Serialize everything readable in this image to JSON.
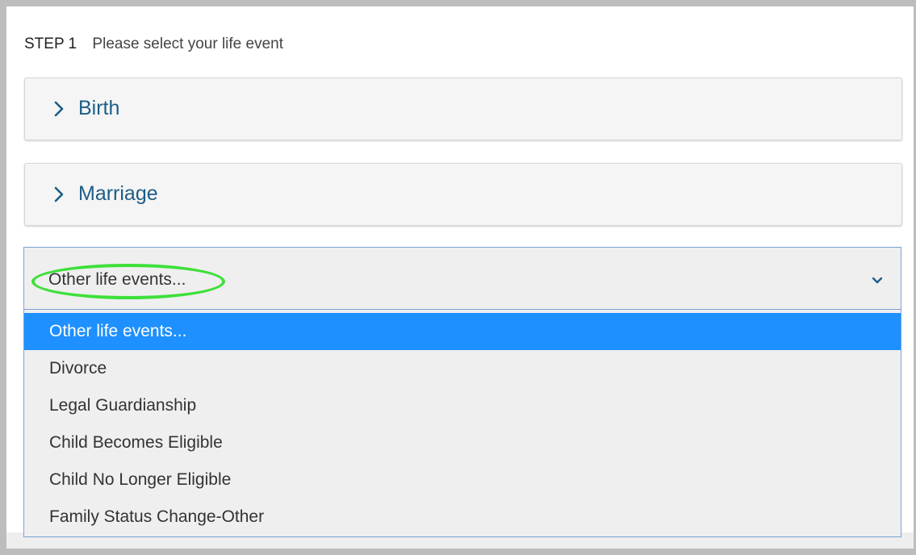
{
  "step": {
    "number": "STEP 1",
    "instruction": "Please select your life event"
  },
  "accordion": [
    {
      "label": "Birth",
      "icon": "chevron-right-icon"
    },
    {
      "label": "Marriage",
      "icon": "chevron-right-icon"
    }
  ],
  "select": {
    "value": "Other life events...",
    "icon": "chevron-down-icon",
    "options": [
      "Other life events...",
      "Divorce",
      "Legal Guardianship",
      "Child Becomes Eligible",
      "Child No Longer Eligible",
      "Family Status Change-Other"
    ],
    "selected_index": 0
  },
  "colors": {
    "accent": "#1e90ff",
    "link": "#1c5e87",
    "annotation": "#3ee03a"
  }
}
